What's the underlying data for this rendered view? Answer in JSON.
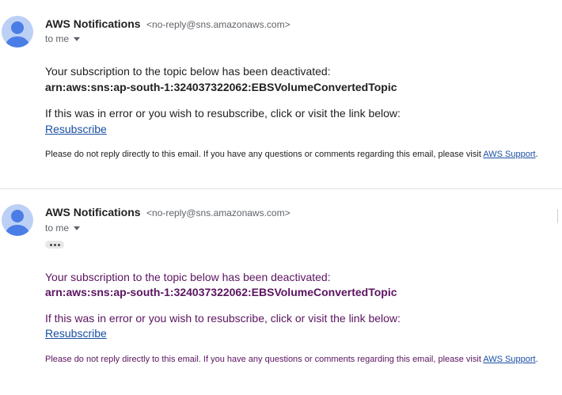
{
  "messages": [
    {
      "sender_name": "AWS Notifications",
      "sender_email": "<no-reply@sns.amazonaws.com>",
      "to_label": "to me",
      "line1": "Your subscription to the topic below has been deactivated:",
      "arn": "arn:aws:sns:ap-south-1:324037322062:EBSVolumeConvertedTopic",
      "line2": "If this was in error or you wish to resubscribe, click or visit the link below:",
      "resubscribe_link": "Resubscribe",
      "footer_text": "Please do not reply directly to this email. If you have any questions or comments regarding this email, please visit ",
      "support_link": "AWS Support",
      "footer_end": "."
    },
    {
      "sender_name": "AWS Notifications",
      "sender_email": "<no-reply@sns.amazonaws.com>",
      "to_label": "to me",
      "line1": "Your subscription to the topic below has been deactivated:",
      "arn": "arn:aws:sns:ap-south-1:324037322062:EBSVolumeConvertedTopic",
      "line2": "If this was in error or you wish to resubscribe, click or visit the link below:",
      "resubscribe_link": "Resubscribe",
      "footer_text": "Please do not reply directly to this email. If you have any questions or comments regarding this email, please visit ",
      "support_link": "AWS Support",
      "footer_end": "."
    }
  ],
  "icons": {
    "avatar": "person-avatar-icon",
    "caret": "chevron-down-icon",
    "show_trimmed": "ellipsis-icon"
  },
  "colors": {
    "link": "#1a4fa3",
    "quoted_text": "#5b1460",
    "avatar_bg": "#bcd0f5",
    "avatar_fg": "#4a7ee6"
  }
}
